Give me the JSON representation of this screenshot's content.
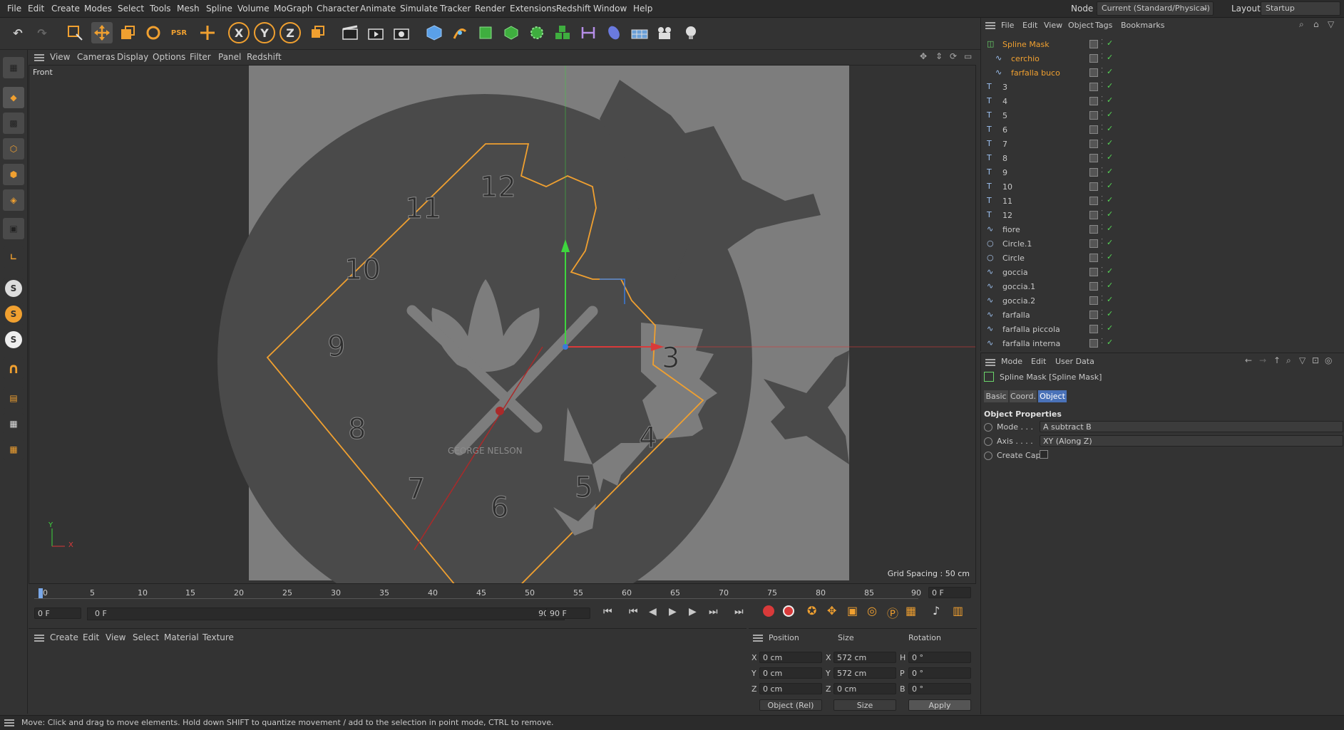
{
  "menubar": {
    "items": [
      "File",
      "Edit",
      "Create",
      "Modes",
      "Select",
      "Tools",
      "Mesh",
      "Spline",
      "Volume",
      "MoGraph",
      "Character",
      "Animate",
      "Simulate",
      "Tracker",
      "Render",
      "Extensions",
      "Redshift",
      "Window",
      "Help"
    ],
    "node_space_label": "Node Space:",
    "node_space_value": "Current (Standard/Physical)",
    "layout_label": "Layout:",
    "layout_value": "Startup"
  },
  "toolbar": {
    "axis_x": "X",
    "axis_y": "Y",
    "axis_z": "Z"
  },
  "viewport": {
    "menu": [
      "View",
      "Cameras",
      "Display",
      "Options",
      "Filter",
      "Panel",
      "Redshift"
    ],
    "view_name": "Front",
    "grid_spacing": "Grid Spacing : 50 cm",
    "clock_numbers": [
      "12",
      "11",
      "10",
      "9",
      "8",
      "7",
      "6",
      "5",
      "4",
      "3"
    ],
    "brand": "GEORGE NELSON",
    "axis_x_label": "X",
    "axis_y_label": "Y"
  },
  "timeline": {
    "ticks": [
      "0",
      "5",
      "10",
      "15",
      "20",
      "25",
      "30",
      "35",
      "40",
      "45",
      "50",
      "55",
      "60",
      "65",
      "70",
      "75",
      "80",
      "85",
      "90"
    ],
    "current_frame": "0 F",
    "start_frame": "0 F",
    "range_start": "0 F",
    "range_end": "90 F",
    "end_frame": "90 F"
  },
  "material_manager": {
    "menu": [
      "Create",
      "Edit",
      "View",
      "Select",
      "Material",
      "Texture"
    ]
  },
  "coordinates": {
    "headers": [
      "Position",
      "Size",
      "Rotation"
    ],
    "rows": [
      {
        "axis": "X",
        "pos": "0 cm",
        "size_axis": "X",
        "size": "572 cm",
        "rot_axis": "H",
        "rot": "0 °"
      },
      {
        "axis": "Y",
        "pos": "0 cm",
        "size_axis": "Y",
        "size": "572 cm",
        "rot_axis": "P",
        "rot": "0 °"
      },
      {
        "axis": "Z",
        "pos": "0 cm",
        "size_axis": "Z",
        "size": "0 cm",
        "rot_axis": "B",
        "rot": "0 °"
      }
    ],
    "mode_select": "Object (Rel)",
    "size_select": "Size",
    "apply": "Apply"
  },
  "object_manager": {
    "menu": [
      "File",
      "Edit",
      "View",
      "Object",
      "Tags",
      "Bookmarks"
    ],
    "objects": [
      {
        "name": "Spline Mask",
        "kind": "mask",
        "selected": true,
        "indent": 0
      },
      {
        "name": "cerchio",
        "kind": "spline",
        "selected": true,
        "indent": 1
      },
      {
        "name": "farfalla buco",
        "kind": "spline",
        "selected": true,
        "indent": 1
      },
      {
        "name": "3",
        "kind": "text",
        "selected": false,
        "indent": 0
      },
      {
        "name": "4",
        "kind": "text",
        "selected": false,
        "indent": 0
      },
      {
        "name": "5",
        "kind": "text",
        "selected": false,
        "indent": 0
      },
      {
        "name": "6",
        "kind": "text",
        "selected": false,
        "indent": 0
      },
      {
        "name": "7",
        "kind": "text",
        "selected": false,
        "indent": 0
      },
      {
        "name": "8",
        "kind": "text",
        "selected": false,
        "indent": 0
      },
      {
        "name": "9",
        "kind": "text",
        "selected": false,
        "indent": 0
      },
      {
        "name": "10",
        "kind": "text",
        "selected": false,
        "indent": 0
      },
      {
        "name": "11",
        "kind": "text",
        "selected": false,
        "indent": 0
      },
      {
        "name": "12",
        "kind": "text",
        "selected": false,
        "indent": 0
      },
      {
        "name": "fiore",
        "kind": "spline",
        "selected": false,
        "indent": 0
      },
      {
        "name": "Circle.1",
        "kind": "circle",
        "selected": false,
        "indent": 0
      },
      {
        "name": "Circle",
        "kind": "circle",
        "selected": false,
        "indent": 0
      },
      {
        "name": "goccia",
        "kind": "spline",
        "selected": false,
        "indent": 0
      },
      {
        "name": "goccia.1",
        "kind": "spline",
        "selected": false,
        "indent": 0
      },
      {
        "name": "goccia.2",
        "kind": "spline",
        "selected": false,
        "indent": 0
      },
      {
        "name": "farfalla",
        "kind": "spline",
        "selected": false,
        "indent": 0
      },
      {
        "name": "farfalla piccola",
        "kind": "spline",
        "selected": false,
        "indent": 0
      },
      {
        "name": "farfalla interna",
        "kind": "spline",
        "selected": false,
        "indent": 0
      }
    ]
  },
  "attributes": {
    "menu": [
      "Mode",
      "Edit",
      "User Data"
    ],
    "title": "Spline Mask [Spline Mask]",
    "tabs": [
      "Basic",
      "Coord.",
      "Object"
    ],
    "active_tab": "Object",
    "section": "Object Properties",
    "mode_label": "Mode . . .",
    "mode_value": "A subtract B",
    "axis_label": "Axis . . . .",
    "axis_value": "XY (Along Z)",
    "cap_label": "Create Cap"
  },
  "status": {
    "text": "Move: Click and drag to move elements. Hold down SHIFT to quantize movement / add to the selection in point mode, CTRL to remove."
  },
  "colors": {
    "accent": "#f0a030",
    "selected_text": "#f0a030",
    "check_green": "#55d455",
    "axis_red": "#d93a3a",
    "axis_green": "#3ed63e",
    "axis_blue": "#3a7ad9"
  }
}
